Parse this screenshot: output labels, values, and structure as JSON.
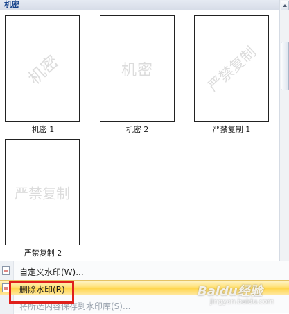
{
  "gallery": {
    "section_header": "机密",
    "items": [
      {
        "caption": "机密 1",
        "watermark_text": "机密"
      },
      {
        "caption": "机密 2",
        "watermark_text": "机密"
      },
      {
        "caption": "严禁复制 1",
        "watermark_text": "严禁复制"
      },
      {
        "caption": "严禁复制 2",
        "watermark_text": "严禁复制"
      }
    ]
  },
  "menu": {
    "items": [
      {
        "label": "自定义水印(W)...",
        "icon": "watermark-icon",
        "state": "normal"
      },
      {
        "label": "删除水印(R)",
        "icon": "watermark-remove-icon",
        "state": "highlighted"
      },
      {
        "label": "将所选内容保存到水印库(S)...",
        "icon": "",
        "state": "disabled"
      }
    ]
  },
  "overlay": {
    "brand": "Baidu经验",
    "url": "jingyan.baidu.com"
  },
  "colors": {
    "highlight": "#ffd54a",
    "header_text": "#15428b",
    "annotation_box": "#e0201b"
  }
}
